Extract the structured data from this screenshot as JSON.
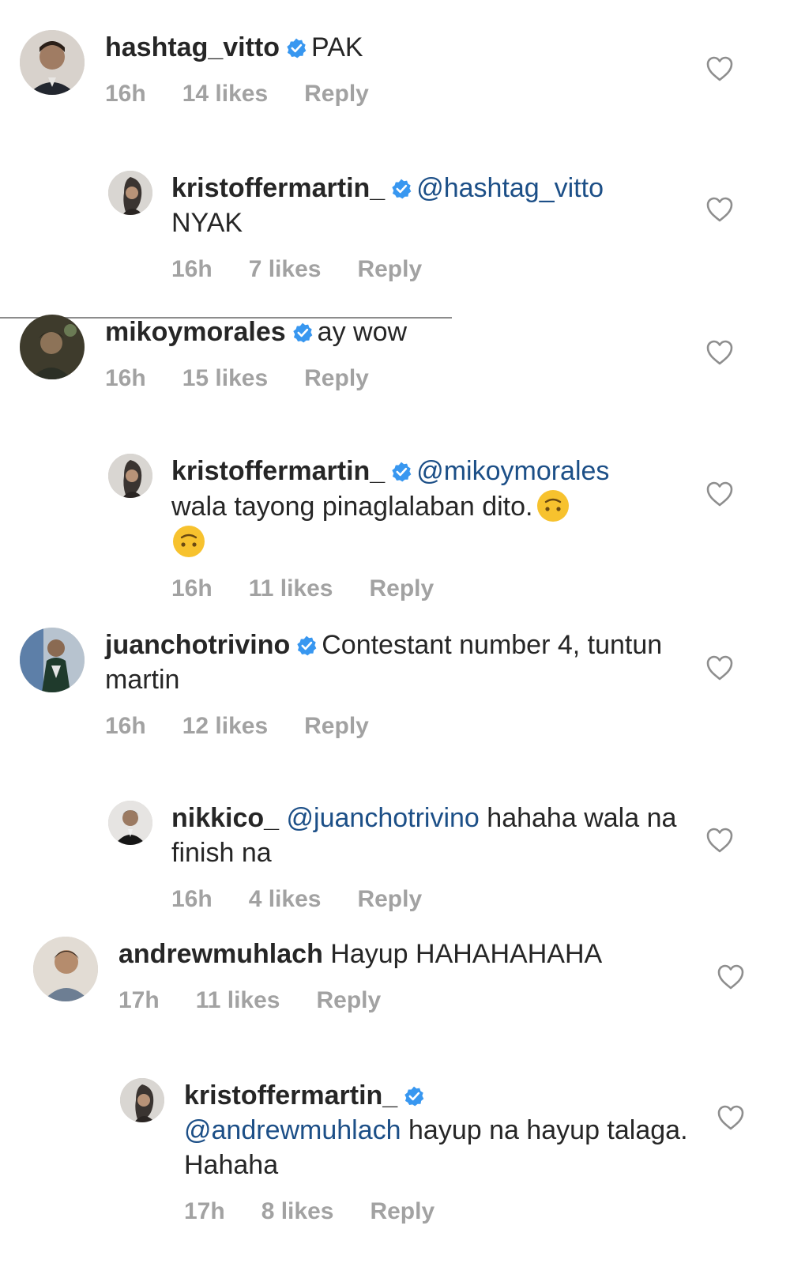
{
  "comments": [
    {
      "username": "hashtag_vitto",
      "verified": true,
      "mention": "",
      "text": "PAK",
      "time": "16h",
      "likes": "14 likes",
      "reply_label": "Reply"
    },
    {
      "username": "kristoffermartin_",
      "verified": true,
      "mention": "@hashtag_vitto",
      "text": "NYAK",
      "time": "16h",
      "likes": "7 likes",
      "reply_label": "Reply"
    },
    {
      "username": "mikoymorales",
      "verified": true,
      "mention": "",
      "text": "ay wow",
      "time": "16h",
      "likes": "15 likes",
      "reply_label": "Reply"
    },
    {
      "username": "kristoffermartin_",
      "verified": true,
      "mention": "@mikoymorales",
      "text": "wala tayong pinaglalaban dito.",
      "emoji": "upside-down-face-emoji",
      "time": "16h",
      "likes": "11 likes",
      "reply_label": "Reply"
    },
    {
      "username": "juanchotrivino",
      "verified": true,
      "mention": "",
      "text": "Contestant number 4, tuntun martin",
      "time": "16h",
      "likes": "12 likes",
      "reply_label": "Reply"
    },
    {
      "username": "nikkico_",
      "verified": false,
      "mention": "@juanchotrivino",
      "text": "hahaha wala na finish na",
      "time": "16h",
      "likes": "4 likes",
      "reply_label": "Reply"
    },
    {
      "username": "andrewmuhlach",
      "verified": false,
      "mention": "",
      "text": "Hayup HAHAHAHAHA",
      "time": "17h",
      "likes": "11 likes",
      "reply_label": "Reply"
    },
    {
      "username": "kristoffermartin_",
      "verified": true,
      "mention": "@andrewmuhlach",
      "text": "hayup na hayup talaga. Hahaha",
      "time": "17h",
      "likes": "8 likes",
      "reply_label": "Reply"
    }
  ],
  "colors": {
    "verified_badge": "#3897f0",
    "mention": "#1c4f87",
    "meta": "#a2a2a2"
  },
  "icons": {
    "verified": "verified-badge-icon",
    "like": "heart-outline-icon"
  }
}
